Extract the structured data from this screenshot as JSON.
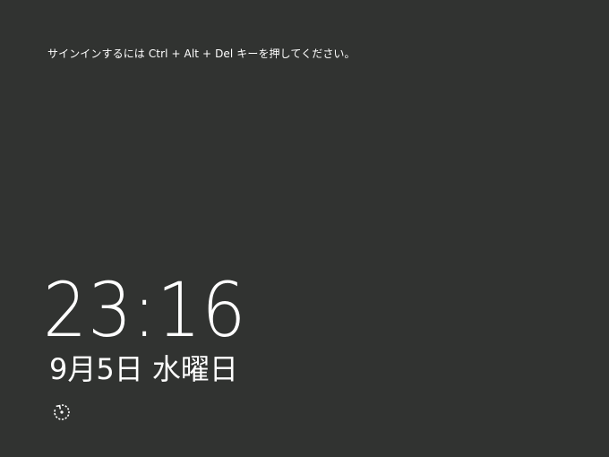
{
  "lock_screen": {
    "prompt": "サインインするには Ctrl + Alt + Del キーを押してください。",
    "time": "23:16",
    "date": "9月5日 水曜日",
    "background_color": "#313331",
    "text_color": "#ffffff",
    "ease_of_access_icon": "ease-of-access-icon"
  }
}
